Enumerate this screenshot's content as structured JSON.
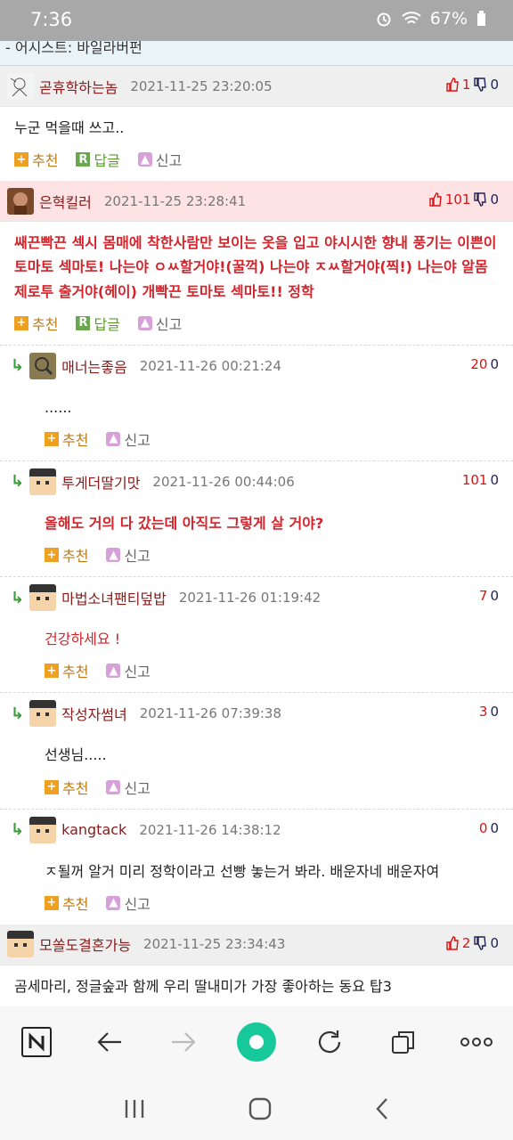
{
  "status": {
    "time": "7:36",
    "battery": "67%"
  },
  "top_cut": "- 어시스트: 바일라버펀",
  "labels": {
    "recommend": "추천",
    "reply": "답글",
    "report": "신고"
  },
  "comments": [
    {
      "nick": "곧휴학하는놈",
      "date": "2021-11-25 23:20:05",
      "up": "1",
      "down": "0",
      "text": "누군 먹을때 쓰고..",
      "bg": "gray"
    },
    {
      "nick": "은혁킬러",
      "date": "2021-11-25 23:28:41",
      "up": "101",
      "down": "0",
      "text": "쌔끈빡끈 섹시 몸매에 착한사람만 보이는 옷을 입고 야시시한 향내 풍기는 이쁜이 토마토 섹마토! 나는야 ㅇㅆ할거야!(꿀꺽) 나는야 ㅈㅆ할거야(찍!) 나는야 알몸 제로투 출거야(헤이) 개빡끈 토마토 섹마토!! 정학",
      "bg": "pink"
    }
  ],
  "replies": [
    {
      "nick": "매너는좋음",
      "date": "2021-11-26 00:21:24",
      "up": "20",
      "down": "0",
      "text": "......"
    },
    {
      "nick": "투게더딸기맛",
      "date": "2021-11-26 00:44:06",
      "up": "101",
      "down": "0",
      "text": "올해도 거의 다 갔는데 아직도 그렇게 살 거야?"
    },
    {
      "nick": "마법소녀팬티덮밥",
      "date": "2021-11-26 01:19:42",
      "up": "7",
      "down": "0",
      "text": "건강하세요 !"
    },
    {
      "nick": "작성자썸녀",
      "date": "2021-11-26 07:39:38",
      "up": "3",
      "down": "0",
      "text": "선생님....."
    },
    {
      "nick": "kangtack",
      "date": "2021-11-26 14:38:12",
      "up": "0",
      "down": "0",
      "text": "ㅈ될꺼 알거 미리 정학이라고 선빵 놓는거 봐라. 배운자네 배운자여"
    }
  ],
  "last": {
    "nick": "모쏠도결혼가능",
    "date": "2021-11-25 23:34:43",
    "up": "2",
    "down": "0",
    "text": "곰세마리, 정글숲과 함께 우리 딸내미가 가장 좋아하는 동요 탑3"
  },
  "colors": {
    "accent_red": "#d4232b",
    "nick": "#8b1a1a",
    "pink_bg": "#fde3e4",
    "gray_bg": "#efefef"
  }
}
